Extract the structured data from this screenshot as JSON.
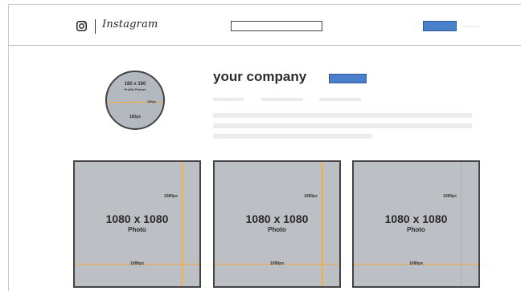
{
  "header": {
    "logo_text": "Instagram",
    "icons": [
      "instagram-camera-icon"
    ]
  },
  "profile": {
    "avatar_size_label": "180 x 180",
    "avatar_caption": "Profile Picture",
    "avatar_side_label": "180px",
    "avatar_bottom_label": "180px",
    "company_name": "your company"
  },
  "posts": [
    {
      "size_label": "1080 x 1080",
      "caption": "Photo",
      "side_label": "1080px",
      "bottom_label": "1080px"
    },
    {
      "size_label": "1080 x 1080",
      "caption": "Photo",
      "side_label": "1080px",
      "bottom_label": "1080px"
    },
    {
      "size_label": "1080 x 1080",
      "caption": "Photo",
      "side_label": "1080px",
      "bottom_label": "1080px"
    }
  ],
  "colors": {
    "accent_button": "#4a7fc9",
    "guide_line": "#f2a93b",
    "placeholder": "#bcbfc4"
  }
}
